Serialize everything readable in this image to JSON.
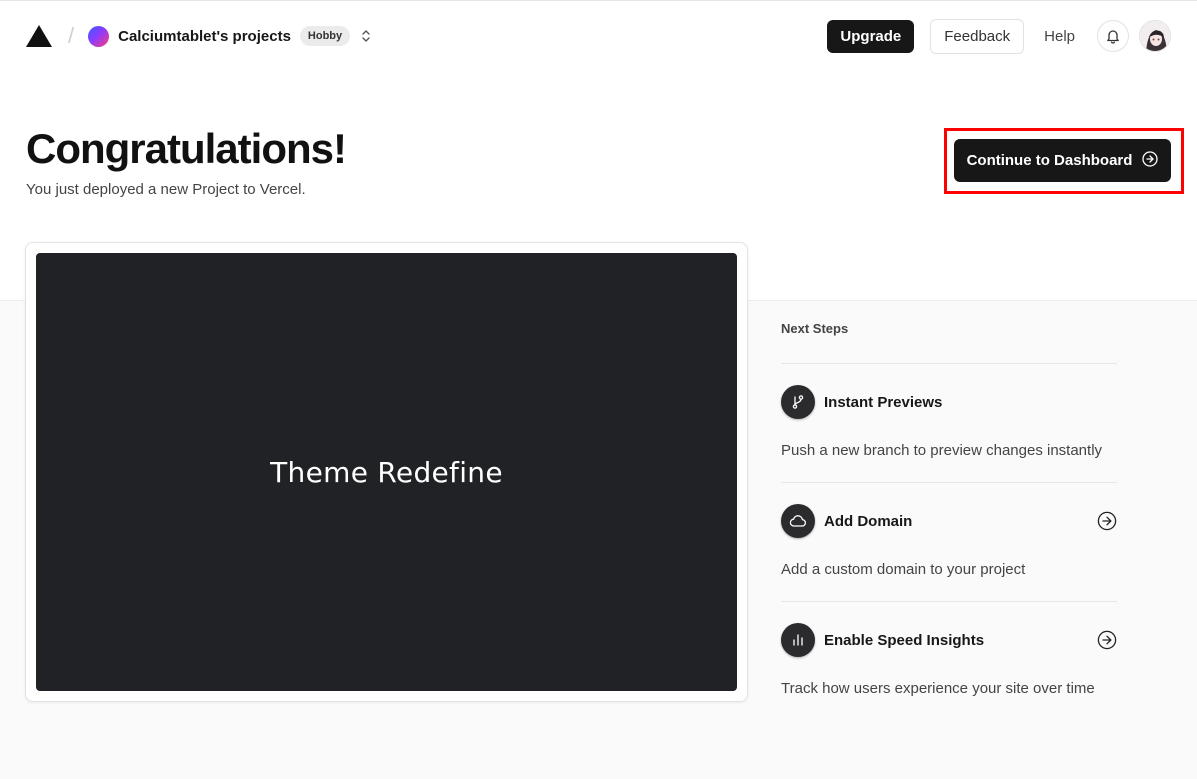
{
  "header": {
    "team_name": "Calciumtablet's projects",
    "plan": "Hobby",
    "upgrade_label": "Upgrade",
    "feedback_label": "Feedback",
    "help_label": "Help"
  },
  "hero": {
    "title": "Congratulations!",
    "subtitle": "You just deployed a new Project to Vercel.",
    "continue_label": "Continue to Dashboard"
  },
  "preview": {
    "site_title": "Theme Redefine"
  },
  "next_steps": {
    "heading": "Next Steps",
    "items": [
      {
        "title": "Instant Previews",
        "description": "Push a new branch to preview changes instantly",
        "icon": "git-branch-icon",
        "has_arrow": false
      },
      {
        "title": "Add Domain",
        "description": "Add a custom domain to your project",
        "icon": "cloud-icon",
        "has_arrow": true
      },
      {
        "title": "Enable Speed Insights",
        "description": "Track how users experience your site over time",
        "icon": "bar-chart-icon",
        "has_arrow": true
      }
    ]
  },
  "colors": {
    "primary": "#171717",
    "highlight": "#ff0000",
    "preview_bg": "#212226",
    "band_bg": "#fafafa"
  }
}
